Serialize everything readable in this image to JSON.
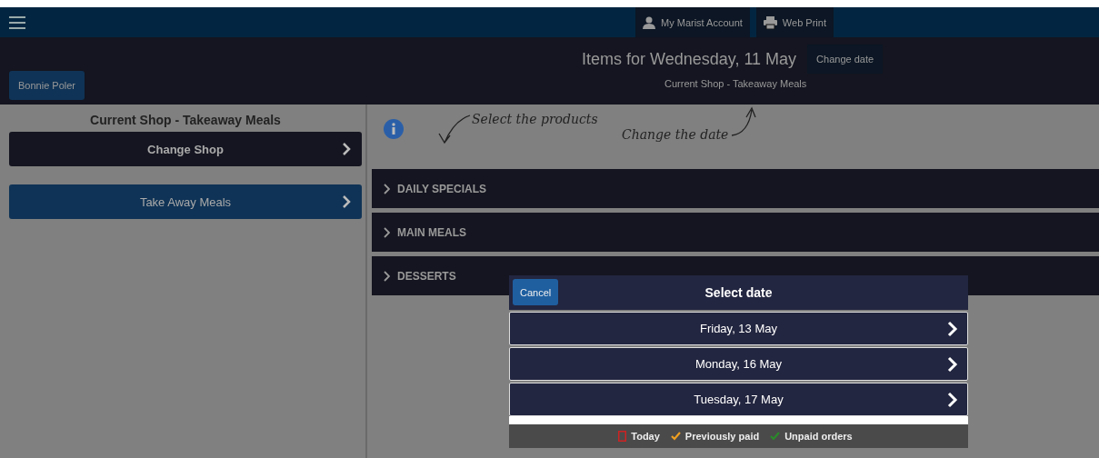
{
  "top_bar": {
    "links": [
      {
        "label": "My Marist Account",
        "kind": "account"
      },
      {
        "label": "Web Print",
        "kind": "print"
      }
    ]
  },
  "header": {
    "title": "Items for Wednesday, 11 May",
    "change_date": "Change date",
    "subtitle": "Current Shop - Takeaway Meals",
    "user": "Bonnie Poler"
  },
  "sidebar": {
    "heading": "Current Shop - Takeaway Meals",
    "change_shop": "Change Shop",
    "shops": [
      {
        "label": "Take Away Meals"
      }
    ]
  },
  "hints": {
    "select_products": "Select the products",
    "change_the_date": "Change the date"
  },
  "categories": [
    {
      "label": "DAILY SPECIALS",
      "expanded": false
    },
    {
      "label": "MAIN MEALS",
      "expanded": false
    },
    {
      "label": "DESSERTS",
      "expanded": false
    }
  ],
  "dialog": {
    "cancel": "Cancel",
    "title": "Select date",
    "dates": [
      {
        "label": "Friday, 13 May"
      },
      {
        "label": "Monday, 16 May"
      },
      {
        "label": "Tuesday, 17 May"
      }
    ],
    "legend": [
      {
        "kind": "box",
        "label": "Today",
        "color": "#cc2222"
      },
      {
        "kind": "check",
        "label": "Previously paid",
        "color": "#f0a020"
      },
      {
        "kind": "check",
        "label": "Unpaid orders",
        "color": "#2a8a2a"
      }
    ]
  }
}
